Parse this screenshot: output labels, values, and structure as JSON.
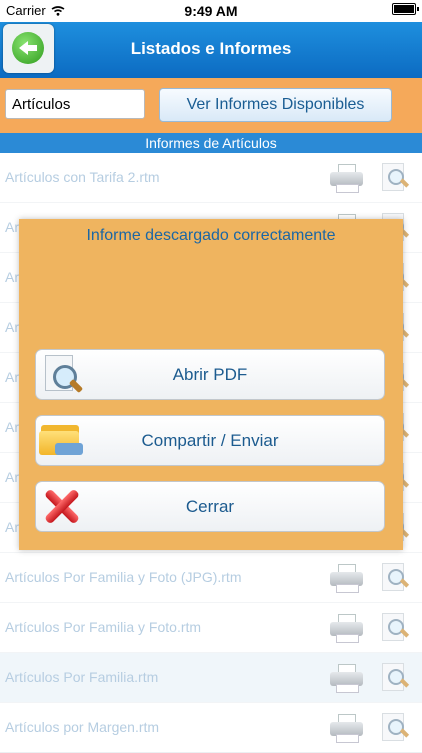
{
  "status_bar": {
    "carrier": "Carrier",
    "time": "9:49 AM"
  },
  "header": {
    "title": "Listados e Informes"
  },
  "toolbar": {
    "select_value": "Artículos",
    "reports_button": "Ver Informes Disponibles"
  },
  "section_title": "Informes de Artículos",
  "list": {
    "items": [
      {
        "label": "Artículos con Tarifa 2.rtm"
      },
      {
        "label": "Art"
      },
      {
        "label": "Art"
      },
      {
        "label": "Art"
      },
      {
        "label": "Art"
      },
      {
        "label": "Art"
      },
      {
        "label": "Art"
      },
      {
        "label": "Art"
      },
      {
        "label": "Artículos Por Familia y Foto (JPG).rtm"
      },
      {
        "label": "Artículos Por Familia y Foto.rtm"
      },
      {
        "label": "Artículos Por Familia.rtm"
      },
      {
        "label": "Artículos por Margen.rtm"
      }
    ]
  },
  "dialog": {
    "message": "Informe descargado correctamente",
    "open_pdf": "Abrir PDF",
    "share": "Compartir / Enviar",
    "close": "Cerrar"
  }
}
